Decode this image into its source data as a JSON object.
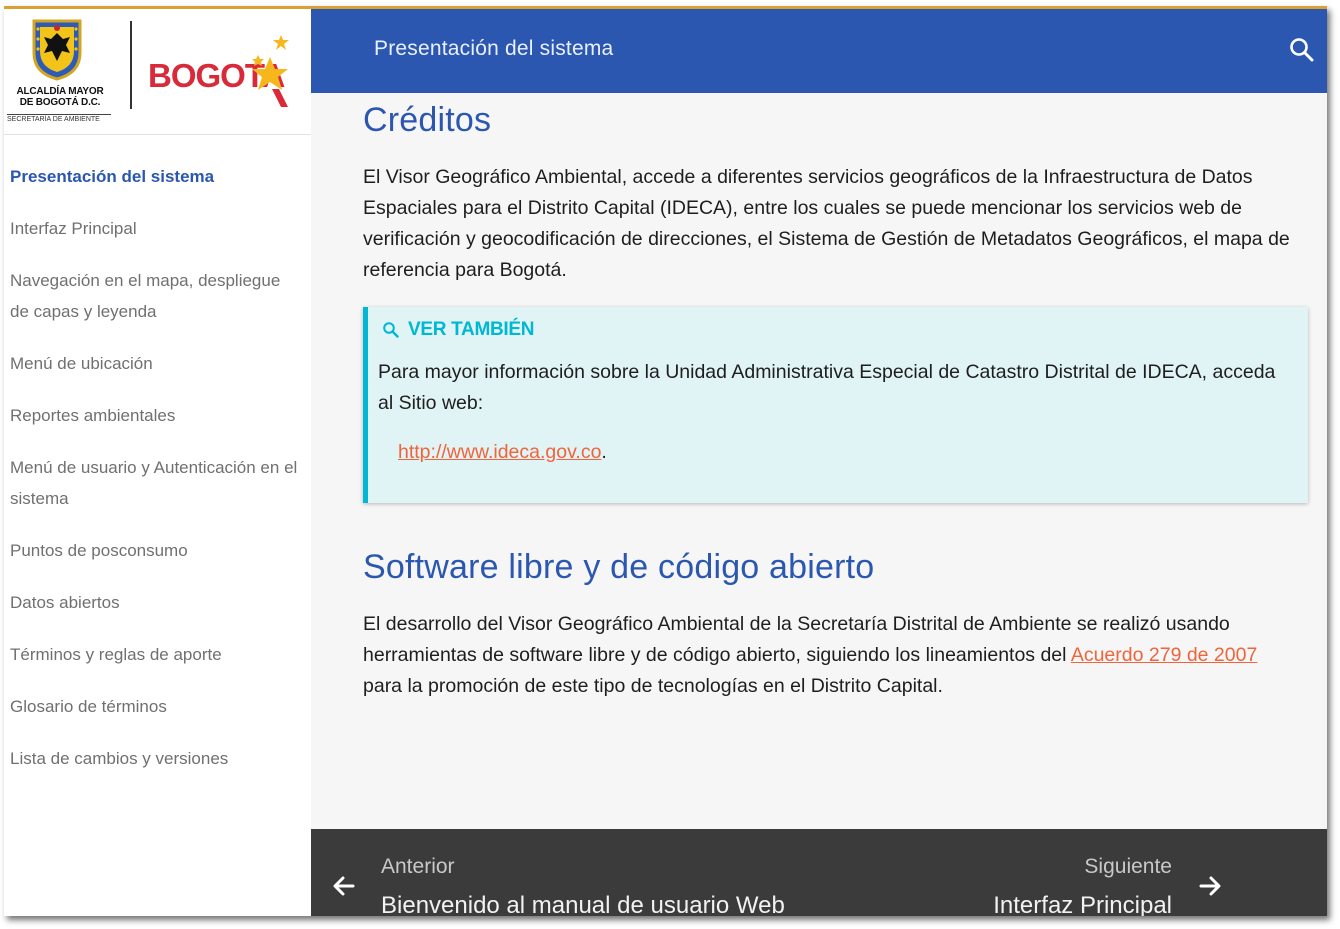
{
  "logo": {
    "line1": "ALCALDÍA MAYOR",
    "line2": "DE BOGOTÁ D.C.",
    "line3": "SECRETARÍA DE AMBIENTE",
    "city": "BOGOTA"
  },
  "header": {
    "title": "Presentación del sistema",
    "search_icon": "search-icon"
  },
  "sidebar": {
    "items": [
      {
        "label": "Presentación del sistema",
        "active": true
      },
      {
        "label": "Interfaz Principal"
      },
      {
        "label": "Navegación en el mapa, despliegue de capas y leyenda"
      },
      {
        "label": "Menú de ubicación"
      },
      {
        "label": "Reportes ambientales"
      },
      {
        "label": "Menú de usuario y Autenticación en el sistema"
      },
      {
        "label": "Puntos de posconsumo"
      },
      {
        "label": "Datos abiertos"
      },
      {
        "label": "Términos y reglas de aporte"
      },
      {
        "label": "Glosario de términos"
      },
      {
        "label": "Lista de cambios y versiones"
      }
    ]
  },
  "content": {
    "creditos": {
      "heading": "Créditos",
      "text": "El Visor Geográfico Ambiental, accede a diferentes servicios geográficos de la Infraestructura de Datos Espaciales para el Distrito Capital (IDECA), entre los cuales se puede mencionar los servicios web de verificación y geocodificación de direcciones, el Sistema de Gestión de Metadatos Geográficos, el mapa de referencia para Bogotá."
    },
    "admonition": {
      "title": "VER TAMBIÉN",
      "text": "Para mayor información sobre la Unidad Administrativa Especial de Catastro Distrital de IDECA, acceda al Sitio web:",
      "link": "http://www.ideca.gov.co",
      "link_suffix": "."
    },
    "software": {
      "heading": "Software libre y de código abierto",
      "text_before": "El desarrollo del Visor Geográfico Ambiental de la Secretaría Distrital de Ambiente se realizó usando herramientas de software libre y de código abierto, siguiendo los lineamientos del ",
      "link": "Acuerdo 279 de 2007",
      "text_after": " para la promoción de este tipo de tecnologías en el Distrito Capital."
    }
  },
  "footer": {
    "prev_label": "Anterior",
    "prev_title": "Bienvenido al manual de usuario Web",
    "next_label": "Siguiente",
    "next_title": "Interfaz Principal"
  },
  "colors": {
    "primary": "#2b57b0",
    "accent_link": "#f0643c",
    "admonition": "#00b8d4",
    "footer": "#3b3b3b"
  }
}
